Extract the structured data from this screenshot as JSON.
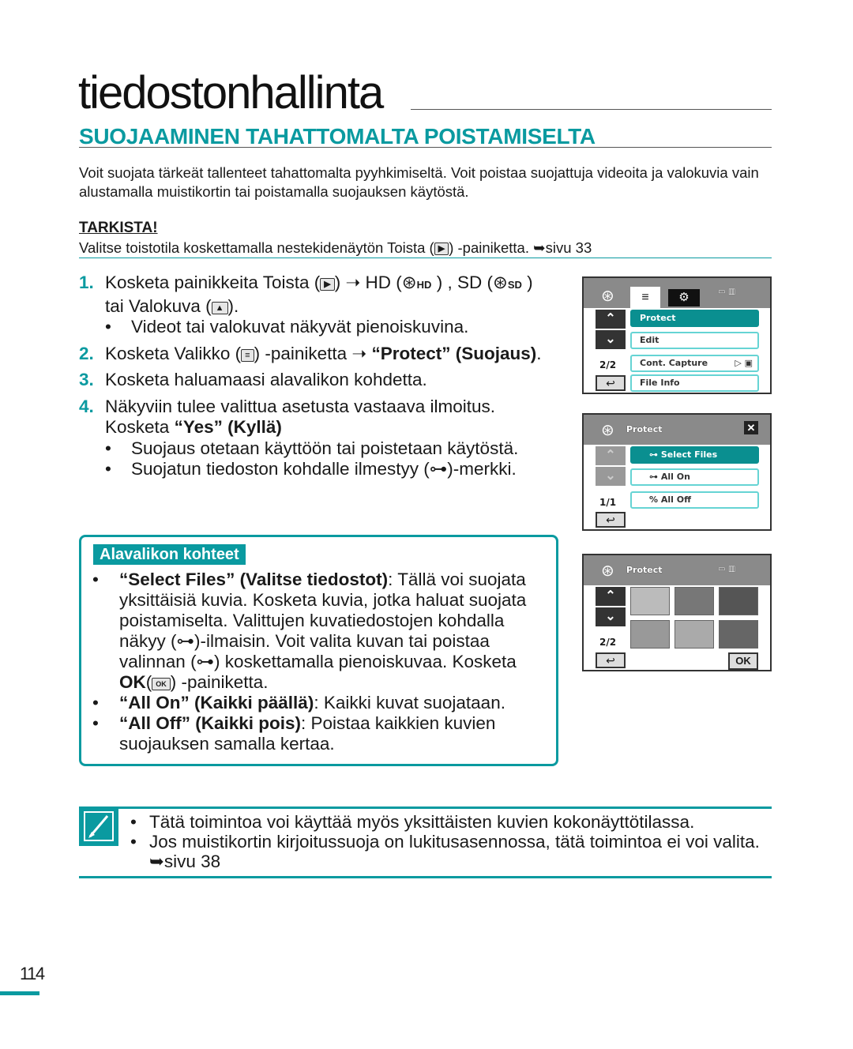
{
  "title": "tiedostonhallinta",
  "section_title": "SUOJAAMINEN TAHATTOMALTA POISTAMISELTA",
  "intro": "Voit suojata tärkeät tallenteet tahattomalta pyyhkimiseltä. Voit poistaa suojattuja videoita ja valokuvia vain alustamalla muistikortin tai poistamalla suojauksen käytöstä.",
  "check": {
    "title": "TARKISTA!",
    "text_a": "Valitse toistotila koskettamalla nestekidenäytön Toista (",
    "text_b": ") -painiketta. ➥sivu 33"
  },
  "steps": [
    {
      "num": "1.",
      "a": "Kosketa painikkeita Toista (",
      "b": ") ➝ HD (",
      "hd": "HD",
      "c": ") , SD (",
      "sd": "SD",
      "d": ")",
      "e": "tai Valokuva (",
      "f": ").",
      "bullets": [
        "Videot tai valokuvat näkyvät pienoiskuvina."
      ]
    },
    {
      "num": "2.",
      "a": "Kosketa Valikko (",
      "b": ") -painiketta ➝ ",
      "bold": "“Protect” (Suojaus)",
      "c": "."
    },
    {
      "num": "3.",
      "a": "Kosketa haluamaasi alavalikon kohdetta."
    },
    {
      "num": "4.",
      "a": "Näkyviin tulee valittua asetusta vastaava ilmoitus.",
      "b": "Kosketa ",
      "bold": "“Yes” (Kyllä)",
      "bullets": [
        "Suojaus otetaan käyttöön tai poistetaan käytöstä.",
        "Suojatun tiedoston kohdalle ilmestyy (⊶)-merkki."
      ]
    }
  ],
  "submenu": {
    "label": "Alavalikon kohteet",
    "items": [
      {
        "bold": "“Select Files” (Valitse tiedostot)",
        "text": ": Tällä voi suojata yksittäisiä kuvia. Kosketa kuvia, jotka haluat suojata poistamiselta. Valittujen kuvatiedostojen kohdalla näkyy (⊶)-ilmaisin. Voit valita kuvan tai poistaa valinnan (⊶) koskettamalla pienoiskuvaa. Kosketa ",
        "ok": "OK",
        "ok_icon": "OK",
        "tail": " -painiketta."
      },
      {
        "bold": "“All On” (Kaikki päällä)",
        "text": ": Kaikki kuvat suojataan."
      },
      {
        "bold": "“All Off” (Kaikki pois)",
        "text": ": Poistaa kaikkien kuvien suojauksen samalla kertaa."
      }
    ]
  },
  "note": {
    "items": [
      "Tätä toimintoa voi käyttää myös yksittäisten kuvien kokonäyttötilassa.",
      "Jos muistikortin kirjoitussuoja on lukitusasennossa, tätä toimintoa ei voi valita. ➥sivu 38"
    ]
  },
  "page_number": "114",
  "screens": {
    "menu": {
      "items": [
        "Protect",
        "Edit",
        "Cont. Capture",
        "File Info"
      ],
      "page": "2/2",
      "selected": 0
    },
    "protect": {
      "title": "Protect",
      "items": [
        "Select Files",
        "All On",
        "All Off"
      ],
      "page": "1/1",
      "selected": 0
    },
    "select": {
      "title": "Protect",
      "page": "2/2",
      "ok": "OK"
    }
  },
  "colors": {
    "accent": "#0a9aa0",
    "selected": "#0a8f90"
  }
}
